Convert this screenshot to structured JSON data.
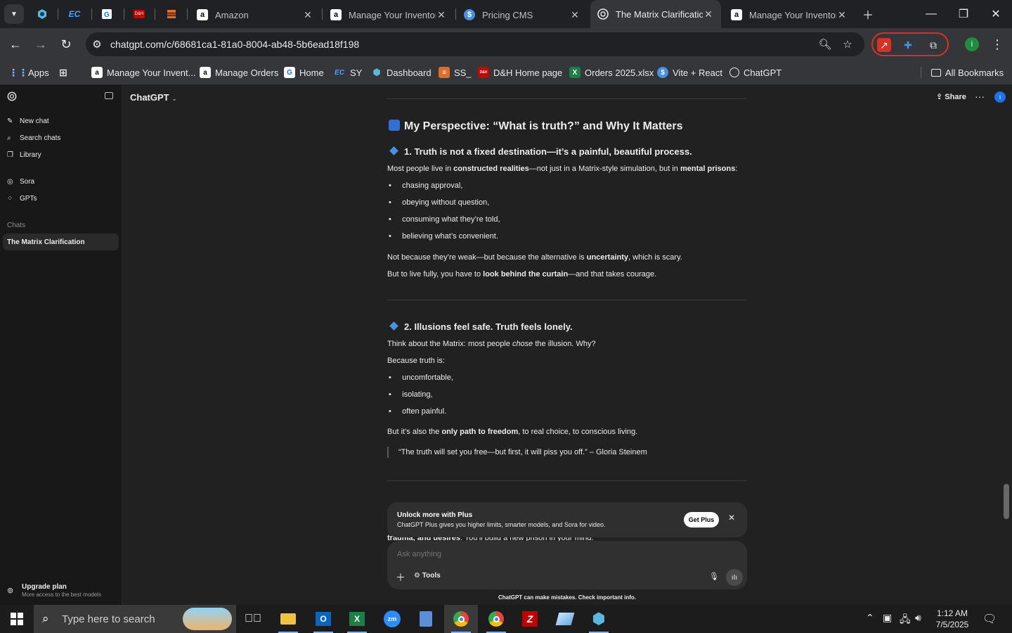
{
  "browser": {
    "tabs": [
      {
        "title": "Amazon",
        "favicon": "amazon-icon"
      },
      {
        "title": "Manage Your Inventor",
        "favicon": "amazon-icon"
      },
      {
        "title": "Pricing CMS",
        "favicon": "dollar-icon"
      },
      {
        "title": "The Matrix Clarificatio",
        "favicon": "chatgpt-icon",
        "active": true
      },
      {
        "title": "Manage Your Inventor",
        "favicon": "amazon-icon"
      }
    ],
    "url": "chatgpt.com/c/68681ca1-81a0-8004-ab48-5b6ead18f198",
    "bookmarks": [
      "Apps",
      "Manage Your Invent...",
      "Manage Orders",
      "Home",
      "SY",
      "Dashboard",
      "SS_",
      "D&H Home page",
      "Orders 2025.xlsx",
      "Vite + React",
      "ChatGPT"
    ],
    "all_bookmarks": "All Bookmarks",
    "profile_initial": "i",
    "pinned_labels": [
      "EC",
      "D&H"
    ],
    "bookmark_icon_labels": [
      "a",
      "a",
      "EC",
      "$"
    ]
  },
  "sidebar": {
    "items": [
      {
        "label": "New chat",
        "icon": "edit-icon"
      },
      {
        "label": "Search chats",
        "icon": "search-icon"
      },
      {
        "label": "Library",
        "icon": "library-icon"
      }
    ],
    "items2": [
      {
        "label": "Sora",
        "icon": "sora-icon"
      },
      {
        "label": "GPTs",
        "icon": "grid-icon"
      }
    ],
    "chats_label": "Chats",
    "active_chat": "The Matrix Clarification",
    "upgrade_title": "Upgrade plan",
    "upgrade_sub": "More access to the best models"
  },
  "header": {
    "model": "ChatGPT",
    "share": "Share",
    "avatar_initial": "i"
  },
  "content": {
    "title": "My Perspective: “What is truth?” and Why It Matters",
    "s1_heading": "1. Truth is not a fixed destination—it’s a painful, beautiful process.",
    "s1_p1_a": "Most people live in ",
    "s1_p1_b": "constructed realities",
    "s1_p1_c": "—not just in a Matrix-style simulation, but in ",
    "s1_p1_d": "mental prisons",
    "s1_p1_e": ":",
    "s1_bullets": [
      "chasing approval,",
      "obeying without question,",
      "consuming what they’re told,",
      "believing what’s convenient."
    ],
    "s1_p2_a": "Not because they’re weak—but because the alternative is ",
    "s1_p2_b": "uncertainty",
    "s1_p2_c": ", which is scary.",
    "s1_p3_a": "But to live fully, you have to ",
    "s1_p3_b": "look behind the curtain",
    "s1_p3_c": "—and that takes courage.",
    "s2_heading": "2. Illusions feel safe. Truth feels lonely.",
    "s2_p1_a": "Think about the Matrix: most people ",
    "s2_p1_b": "chose",
    "s2_p1_c": " the illusion. Why?",
    "s2_p2": "Because truth is:",
    "s2_bullets": [
      "uncomfortable,",
      "isolating,",
      "often painful."
    ],
    "s2_p3_a": "But it’s also the ",
    "s2_p3_b": "only path to freedom",
    "s2_p3_c": ", to real choice, to conscious living.",
    "quote": "“The truth will set you free—but first, it will piss you off.” – Gloria Steinem",
    "partial_a": "trauma, and desires",
    "partial_b": ". You’ll build a new prison in your mind."
  },
  "upsell": {
    "title": "Unlock more with Plus",
    "desc": "ChatGPT Plus gives you higher limits, smarter models, and Sora for video.",
    "button": "Get Plus"
  },
  "composer": {
    "placeholder": "Ask anything",
    "tools": "Tools",
    "disclaimer": "ChatGPT can make mistakes. Check important info."
  },
  "taskbar": {
    "search_placeholder": "Type here to search",
    "time": "1:12 AM",
    "date": "7/5/2025"
  }
}
